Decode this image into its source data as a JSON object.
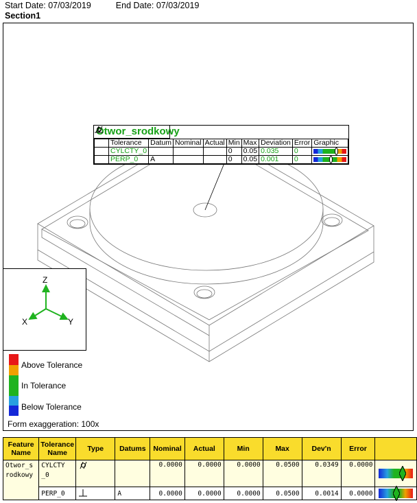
{
  "header": {
    "start_date": "Start Date: 07/03/2019",
    "end_date": "End Date: 07/03/2019",
    "section": "Section1"
  },
  "callout": {
    "feature": "Otwor_srodkowy",
    "columns": [
      "Tolerance",
      "Datum",
      "Nominal",
      "Actual",
      "Min",
      "Max",
      "Deviation",
      "Error",
      "Graphic"
    ],
    "rows": [
      {
        "icon": "cylindricity-icon",
        "tolerance": "CYLCTY_0",
        "datum": "",
        "nominal": "",
        "actual": "",
        "min": "0",
        "max": "0.05",
        "deviation": "0.035",
        "error": "0",
        "marker": 0.7
      },
      {
        "icon": "perpendicularity-icon",
        "tolerance": "PERP_0",
        "datum": "A",
        "nominal": "",
        "actual": "",
        "min": "0",
        "max": "0.05",
        "deviation": "0.001",
        "error": "0",
        "marker": 0.52
      }
    ]
  },
  "axes": {
    "z": "Z",
    "x": "X",
    "y": "Y"
  },
  "legend": {
    "above": "Above Tolerance",
    "in": "In Tolerance",
    "below": "Below Tolerance",
    "colors": [
      "#e81818",
      "#f0a000",
      "#1fb31f",
      "#1fb31f",
      "#28a0e0",
      "#1428d8"
    ]
  },
  "exaggeration": "Form exaggeration: 100x",
  "table": {
    "headers": [
      "Feature Name",
      "Tolerance Name",
      "Type",
      "Datums",
      "Nominal",
      "Actual",
      "Min",
      "Max",
      "Dev'n",
      "Error"
    ],
    "feature_name": "Otwor_s rodkowy",
    "rows": [
      {
        "tolerance": "CYLCTY _0",
        "type_icon": "cylindricity-icon",
        "datums": "",
        "nominal": "0.0000",
        "actual": "0.0000",
        "min": "0.0000",
        "max": "0.0500",
        "devn": "0.0349",
        "error": "0.0000"
      },
      {
        "tolerance": "PERP_0",
        "type_icon": "perpendicularity-icon",
        "datums": "A",
        "nominal": "0.0000",
        "actual": "0.0000",
        "min": "0.0000",
        "max": "0.0500",
        "devn": "0.0014",
        "error": "0.0000"
      }
    ]
  }
}
